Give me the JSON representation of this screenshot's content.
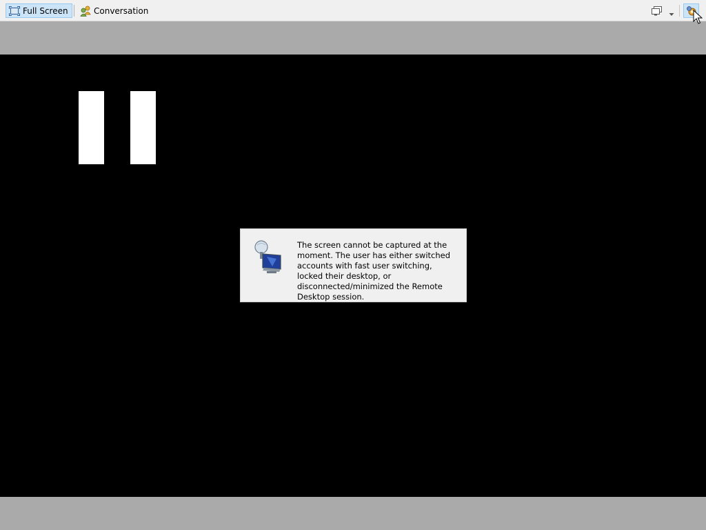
{
  "toolbar": {
    "full_screen_label": "Full Screen",
    "full_screen_icon": "full-screen-icon",
    "conversation_label": "Conversation",
    "conversation_icon": "conversation-icon",
    "display_icon": "monitor-icon",
    "dropdown_icon": "chevron-down-icon",
    "options_icon": "options-icon"
  },
  "remote": {
    "state_icon": "pause-icon",
    "message": "The screen cannot be captured at the moment. The user has either switched accounts with fast user switching, locked their desktop, or disconnected/minimized the Remote Desktop session.",
    "message_icon": "remote-desktop-icon"
  },
  "colors": {
    "toolbar_bg": "#f0f0f0",
    "active_button_bg": "#cce4f7",
    "band_gray": "#aaaaaa",
    "screen_bg": "#000000",
    "dialog_bg": "#f0f0f0"
  }
}
